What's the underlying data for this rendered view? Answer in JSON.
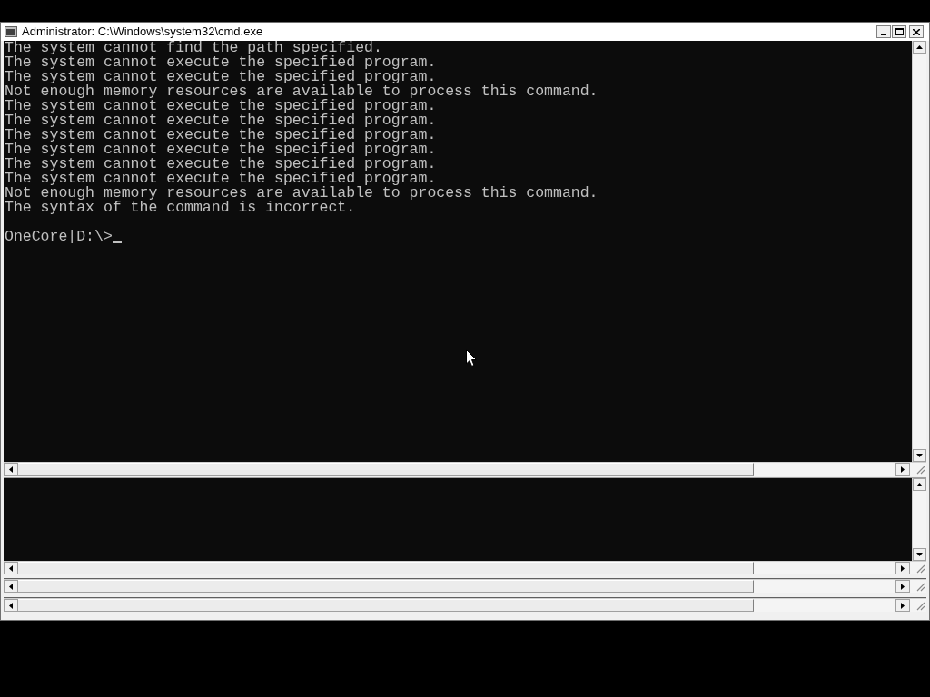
{
  "window": {
    "title": "Administrator: C:\\Windows\\system32\\cmd.exe"
  },
  "console": {
    "lines": [
      "The system cannot find the path specified.",
      "The system cannot execute the specified program.",
      "The system cannot execute the specified program.",
      "Not enough memory resources are available to process this command.",
      "The system cannot execute the specified program.",
      "The system cannot execute the specified program.",
      "The system cannot execute the specified program.",
      "The system cannot execute the specified program.",
      "The system cannot execute the specified program.",
      "The system cannot execute the specified program.",
      "Not enough memory resources are available to process this command.",
      "The syntax of the command is incorrect."
    ],
    "prompt": "OneCore|D:\\>"
  }
}
